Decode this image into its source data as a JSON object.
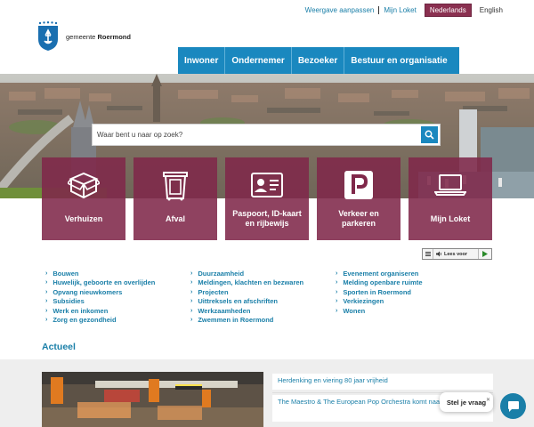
{
  "utility": {
    "weergave": "Weergave aanpassen",
    "loket": "Mijn Loket",
    "lang_active": "Nederlands",
    "lang_other": "English"
  },
  "logo": {
    "prefix": "gemeente",
    "name": "Roermond"
  },
  "nav": {
    "items": [
      "Inwoner",
      "Ondernemer",
      "Bezoeker",
      "Bestuur en organisatie"
    ]
  },
  "search": {
    "placeholder": "Waar bent u naar op zoek?"
  },
  "tiles": [
    {
      "label": "Verhuizen",
      "icon": "moving-box-icon"
    },
    {
      "label": "Afval",
      "icon": "waste-container-icon"
    },
    {
      "label": "Paspoort, ID-kaart en rijbewijs",
      "icon": "id-card-icon"
    },
    {
      "label": "Verkeer en parkeren",
      "icon": "parking-icon"
    },
    {
      "label": "Mijn Loket",
      "icon": "laptop-icon"
    }
  ],
  "leesvoor": {
    "label": "Lees voor"
  },
  "links": {
    "col1": [
      "Bouwen",
      "Huwelijk, geboorte en overlijden",
      "Opvang nieuwkomers",
      "Subsidies",
      "Werk en inkomen",
      "Zorg en gezondheid"
    ],
    "col2": [
      "Duurzaamheid",
      "Meldingen, klachten en bezwaren",
      "Projecten",
      "Uittreksels en afschriften",
      "Werkzaamheden",
      "Zwemmen in Roermond"
    ],
    "col3": [
      "Evenement organiseren",
      "Melding openbare ruimte",
      "Sporten in Roermond",
      "Verkiezingen",
      "Wonen"
    ]
  },
  "actueel": {
    "title": "Actueel",
    "items": [
      "Herdenking en viering 80 jaar vrijheid",
      "The Maestro & The European Pop Orchestra komt naar Roermond"
    ]
  },
  "chat": {
    "prompt": "Stel je vraag",
    "close": "✕"
  },
  "colors": {
    "primary": "#1a88bf",
    "tile": "#80284a",
    "lang_active": "#8a3050",
    "link": "#1a7fa8"
  }
}
